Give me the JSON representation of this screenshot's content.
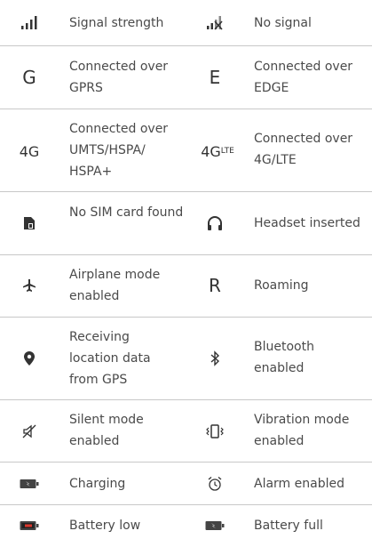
{
  "rows": [
    {
      "left": {
        "icon": "signal-strength-icon",
        "label": "Signal strength"
      },
      "right": {
        "icon": "no-signal-icon",
        "label": "No signal"
      }
    },
    {
      "left": {
        "icon": "gprs-icon",
        "glyph": "G",
        "label": "Connected over GPRS"
      },
      "right": {
        "icon": "edge-icon",
        "glyph": "E",
        "label": "Connected over EDGE"
      }
    },
    {
      "left": {
        "icon": "4g-icon",
        "glyph": "4G",
        "label": "Connected over UMTS/HSPA/ HSPA+"
      },
      "right": {
        "icon": "4g-lte-icon",
        "glyph": "4G",
        "glyph_sup": "LTE",
        "label": "Connected over 4G/LTE"
      }
    },
    {
      "left": {
        "icon": "no-sim-icon",
        "label": "No SIM card found"
      },
      "right": {
        "icon": "headset-icon",
        "label": "Headset inserted"
      }
    },
    {
      "left": {
        "icon": "airplane-icon",
        "label": "Airplane mode enabled"
      },
      "right": {
        "icon": "roaming-icon",
        "glyph": "R",
        "label": "Roaming"
      }
    },
    {
      "left": {
        "icon": "location-pin-icon",
        "label": "Receiving location data from GPS"
      },
      "right": {
        "icon": "bluetooth-icon",
        "label": "Bluetooth enabled"
      }
    },
    {
      "left": {
        "icon": "silent-mode-icon",
        "label": "Silent mode enabled"
      },
      "right": {
        "icon": "vibration-icon",
        "label": "Vibration mode enabled"
      }
    },
    {
      "left": {
        "icon": "charging-battery-icon",
        "label": "Charging"
      },
      "right": {
        "icon": "alarm-clock-icon",
        "label": "Alarm enabled"
      }
    },
    {
      "left": {
        "icon": "battery-low-icon",
        "label": "Battery low"
      },
      "right": {
        "icon": "battery-full-icon",
        "label": "Battery full"
      }
    }
  ]
}
